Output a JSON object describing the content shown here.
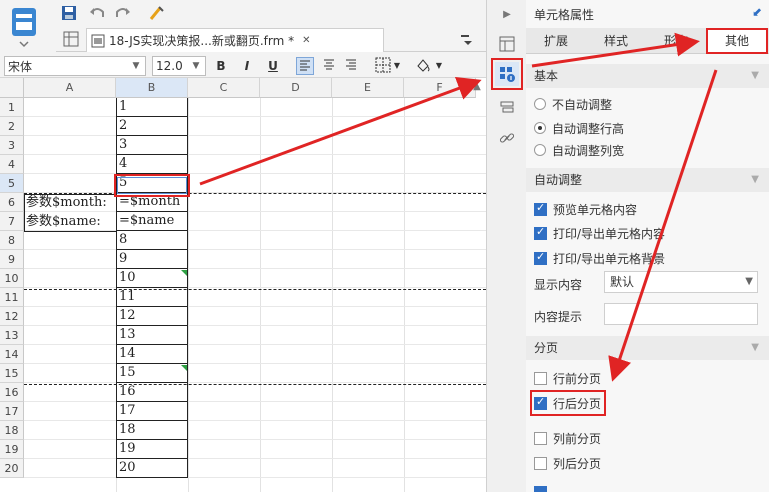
{
  "toolbar": {
    "tab_title": "18-JS实现决策报...新或翻页.frm *",
    "tab_close": "✕"
  },
  "format_bar": {
    "font_name": "宋体",
    "font_size": "12.0",
    "bold": "B",
    "italic": "I",
    "underline": "U"
  },
  "grid": {
    "columns": [
      "A",
      "B",
      "C",
      "D",
      "E",
      "F"
    ],
    "rows": [
      "1",
      "2",
      "3",
      "4",
      "5",
      "6",
      "7",
      "8",
      "9",
      "10",
      "11",
      "12",
      "13",
      "14",
      "15",
      "16",
      "17",
      "18",
      "19",
      "20"
    ],
    "a6": "参数$month:",
    "a7": "参数$name:",
    "b_values": [
      "1",
      "2",
      "3",
      "4",
      "5",
      "=$month",
      "=$name",
      "8",
      "9",
      "10",
      "11",
      "12",
      "13",
      "14",
      "15",
      "16",
      "17",
      "18",
      "19",
      "20"
    ]
  },
  "panel": {
    "title": "单元格属性",
    "tabs": [
      "扩展",
      "样式",
      "形态",
      "其他"
    ],
    "active_tab": "其他",
    "basic": {
      "head": "基本",
      "options": [
        "不自动调整",
        "自动调整行高",
        "自动调整列宽"
      ],
      "selected": "自动调整行高"
    },
    "auto": {
      "head": "自动调整",
      "checks": [
        "预览单元格内容",
        "打印/导出单元格内容",
        "打印/导出单元格背景"
      ],
      "display_label": "显示内容",
      "display_value": "默认",
      "hint_label": "内容提示",
      "hint_value": ""
    },
    "paging": {
      "head": "分页",
      "items": [
        "行前分页",
        "行后分页",
        "列前分页",
        "列后分页"
      ],
      "checked": [
        "行后分页"
      ]
    }
  },
  "colors": {
    "accent": "#2f6fc4",
    "highlight": "#e02424"
  }
}
